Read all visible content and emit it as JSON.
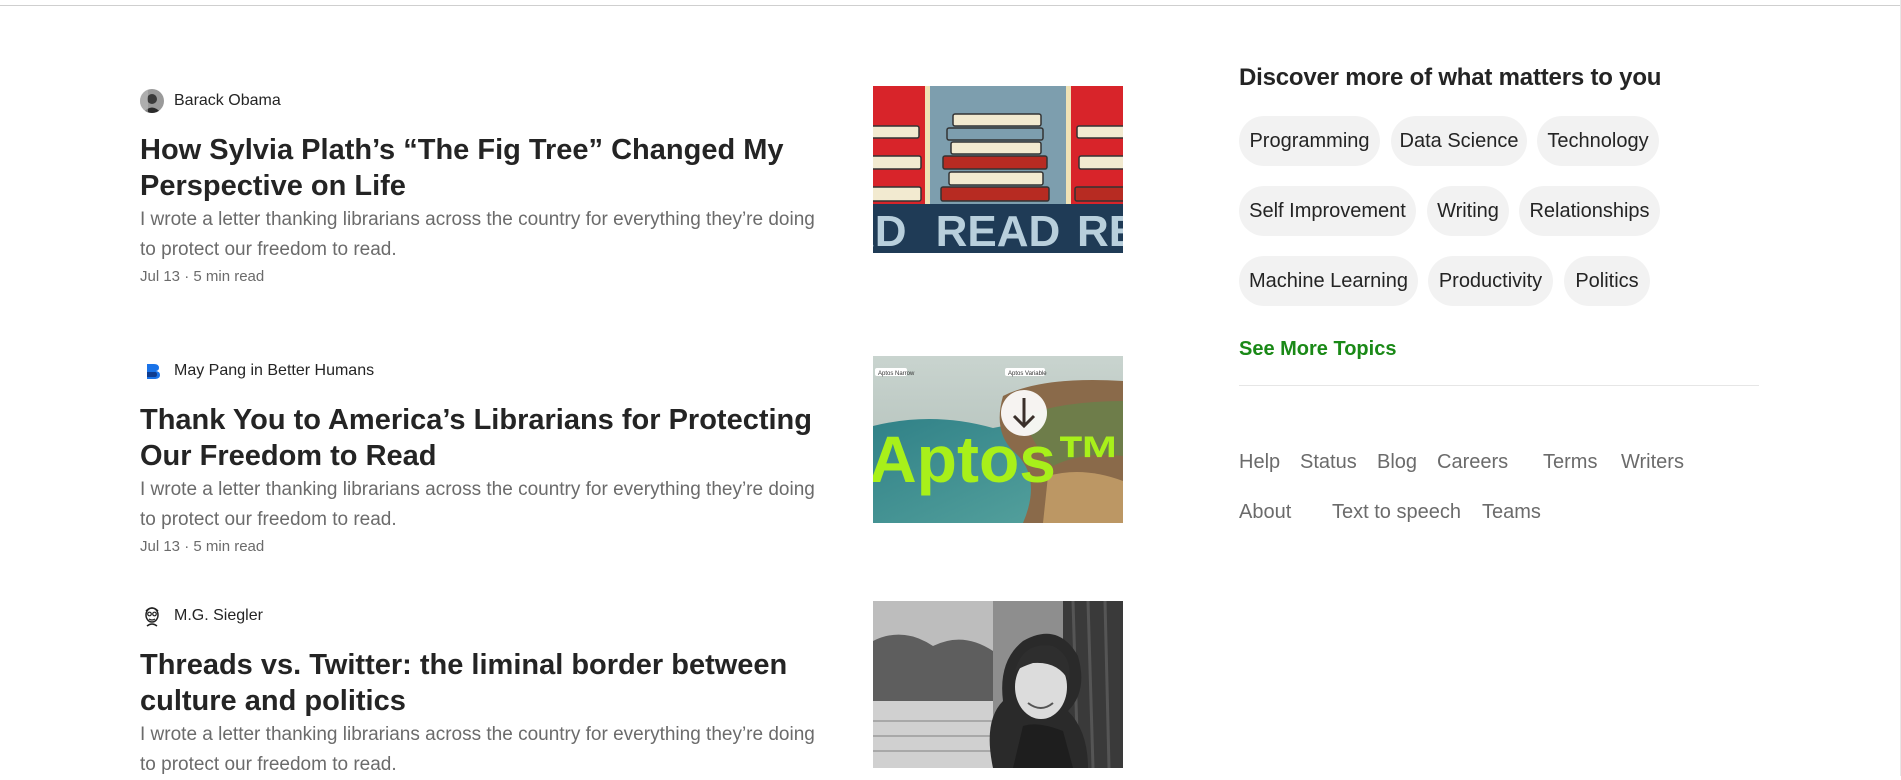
{
  "articles": [
    {
      "author": "Barack Obama",
      "title": "How Sylvia Plath’s “The Fig Tree” Changed My Perspective on Life",
      "subtitle": "I wrote a letter thanking librarians across the country for everything they’re doing to protect our freedom to read.",
      "meta": "Jul 13 · 5 min read",
      "thumb_text": "READ"
    },
    {
      "author": "May Pang in Better Humans",
      "title": "Thank You to America’s Librarians for Protecting Our Freedom to Read",
      "subtitle": "I wrote a letter thanking librarians across the country for everything they’re doing to protect our freedom to read.",
      "meta": "Jul 13 · 5 min read",
      "thumb_text": "Aptos™",
      "thumb_tag_left": "Aptos Narrow",
      "thumb_tag_right": "Aptos Variable"
    },
    {
      "author": "M.G. Siegler",
      "title": "Threads vs. Twitter: the liminal border between culture and politics",
      "subtitle": "I wrote a letter thanking librarians across the country for everything they’re doing to protect our freedom to read."
    }
  ],
  "sidebar": {
    "title": "Discover more of what matters to you",
    "topics": [
      "Programming",
      "Data Science",
      "Technology",
      "Self Improvement",
      "Writing",
      "Relationships",
      "Machine Learning",
      "Productivity",
      "Politics"
    ],
    "see_more": "See More Topics",
    "footer_links": [
      "Help",
      "Status",
      "Blog",
      "Careers",
      "Terms",
      "Writers",
      "About",
      "Text to speech",
      "Teams"
    ]
  },
  "colors": {
    "accent_green": "#1a8917",
    "chip_bg": "#f2f2f2",
    "text_muted": "#6b6b6b",
    "text": "#242424"
  },
  "icons": [
    "avatar-obama-icon",
    "better-humans-logo-icon",
    "avatar-siegler-icon"
  ]
}
